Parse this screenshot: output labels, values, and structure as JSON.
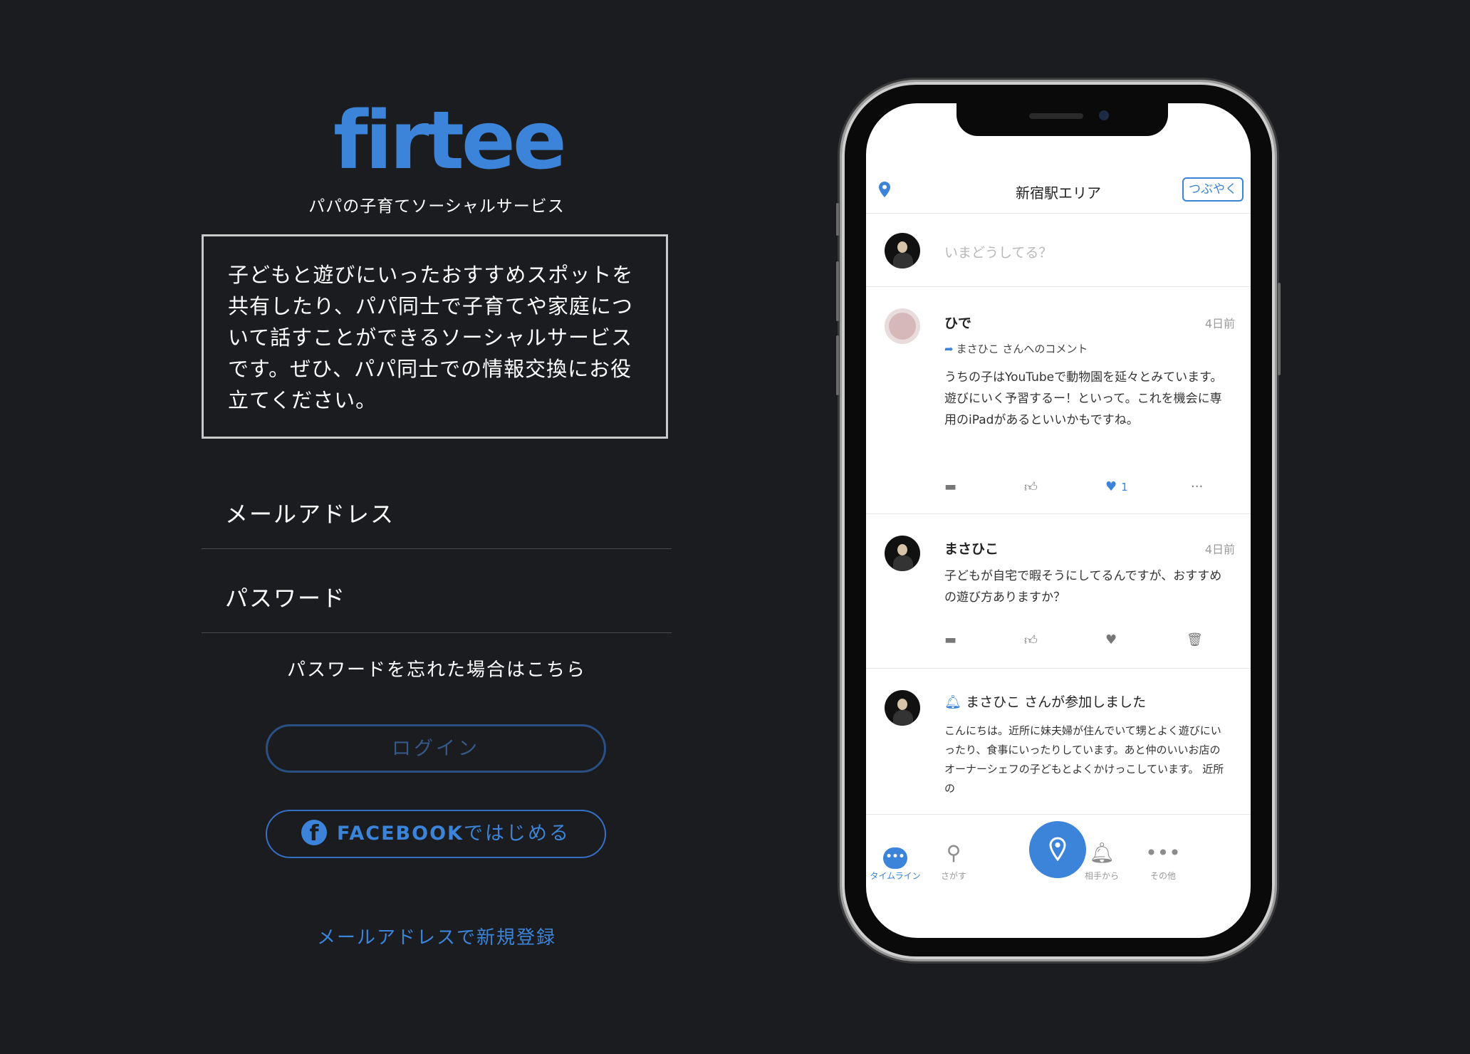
{
  "logo": {
    "text": "firtee"
  },
  "tagline": "パパの子育てソーシャルサービス",
  "description": "子どもと遊びにいったおすすめスポットを共有したり、パパ同士で子育てや家庭について話すことができるソーシャルサービスです。ぜひ、パパ同士での情報交換にお役立てください。",
  "form": {
    "email_label": "メールアドレス",
    "password_label": "パスワード",
    "forgot_link": "パスワードを忘れた場合はこちら",
    "login_button": "ログイン",
    "facebook_brand": "FACEBOOK",
    "facebook_suffix": "ではじめる",
    "register_link": "メールアドレスで新規登録"
  },
  "colors": {
    "background": "#1b1c20",
    "accent": "#3b84d9",
    "login_border": "#2a4f82"
  },
  "phone": {
    "appbar": {
      "area_title": "新宿駅エリア",
      "tweet_button": "つぶやく"
    },
    "compose": {
      "placeholder": "いまどうしてる？"
    },
    "posts": [
      {
        "name": "ひで",
        "time": "4日前",
        "reply_to": "まさひこ さんへのコメント",
        "body": "うちの子はYouTubeで動物園を延々とみています。遊びにいく予習するー！といって。これを機会に専用のiPadがあるといいかもですね。",
        "like_count": "1"
      },
      {
        "name": "まさひこ",
        "time": "4日前",
        "body": "子どもが自宅で暇そうにしてるんですが、おすすめの遊び方ありますか？"
      }
    ],
    "notice": {
      "title": "まさひこ さんが参加しました",
      "body": "こんにちは。近所に妹夫婦が住んでいて甥とよく遊びにいったり、食事にいったりしています。あと仲のいいお店のオーナーシェフの子どもとよくかけっこしています。 近所の"
    },
    "tabs": [
      {
        "label": "タイムライン",
        "icon": "chat-bubble-icon"
      },
      {
        "label": "さがす",
        "icon": "search-icon"
      },
      {
        "label": "相手から",
        "icon": "bell-icon"
      },
      {
        "label": "その他",
        "icon": "more-icon"
      }
    ]
  }
}
